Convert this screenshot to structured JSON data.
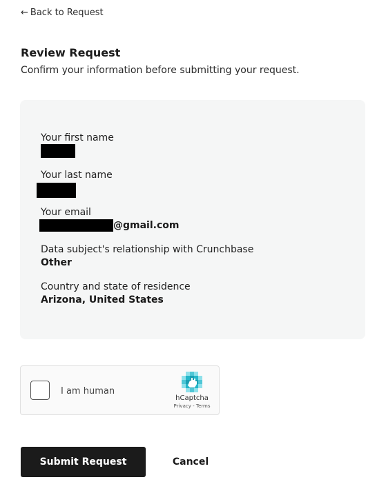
{
  "nav": {
    "back_label": "Back to Request",
    "back_icon": "arrow-left-icon"
  },
  "header": {
    "title": "Review Request",
    "subtitle": "Confirm your information before submitting your request."
  },
  "review": {
    "fields": [
      {
        "label": "Your first name",
        "value": "",
        "redacted": true
      },
      {
        "label": "Your last name",
        "value": "",
        "redacted": true
      },
      {
        "label": "Your email",
        "value": "@gmail.com",
        "redacted_prefix": true
      },
      {
        "label": "Data subject's relationship with Crunchbase",
        "value": "Other"
      },
      {
        "label": "Country and state of residence",
        "value": "Arizona, United States"
      }
    ]
  },
  "captcha": {
    "checkbox_label": "I am human",
    "brand": "hCaptcha",
    "privacy_link": "Privacy",
    "separator": " - ",
    "terms_link": "Terms",
    "checked": false
  },
  "actions": {
    "submit_label": "Submit Request",
    "cancel_label": "Cancel"
  },
  "colors": {
    "card_background": "#f5f6f6",
    "primary_button": "#1b1b1b",
    "captcha_accent": "#24b6c9"
  }
}
